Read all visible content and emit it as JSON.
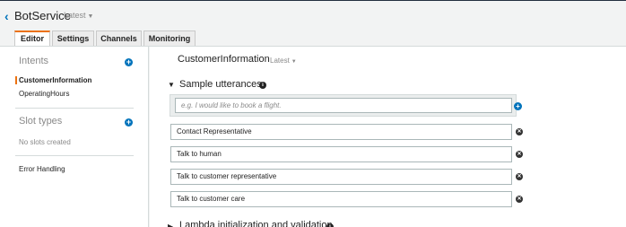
{
  "header": {
    "bot_name": "BotService",
    "version": "Latest"
  },
  "tabs": [
    {
      "label": "Editor"
    },
    {
      "label": "Settings"
    },
    {
      "label": "Channels"
    },
    {
      "label": "Monitoring"
    }
  ],
  "sidebar": {
    "intents_title": "Intents",
    "intents": [
      {
        "label": "CustomerInformation"
      },
      {
        "label": "OperatingHours"
      }
    ],
    "slot_types_title": "Slot types",
    "no_slots_text": "No slots created",
    "error_handling": "Error Handling"
  },
  "main": {
    "intent_title": "CustomerInformation",
    "intent_version": "Latest",
    "sample_utterances_title": "Sample utterances",
    "utterance_placeholder": "e.g. I would like to book a flight.",
    "utterances": [
      {
        "text": "Contact Representative"
      },
      {
        "text": "Talk to human"
      },
      {
        "text": "Talk to customer representative"
      },
      {
        "text": "Talk to customer care"
      }
    ],
    "lambda_section_title": "Lambda initialization and validation"
  },
  "colors": {
    "accent": "#ec7211",
    "link": "#0073bb"
  },
  "icons": {
    "back": "chevron-left-icon",
    "add": "plus-circle-icon",
    "remove": "close-circle-icon",
    "info": "info-icon",
    "expand": "caret-down-icon",
    "collapsed": "caret-right-icon"
  }
}
